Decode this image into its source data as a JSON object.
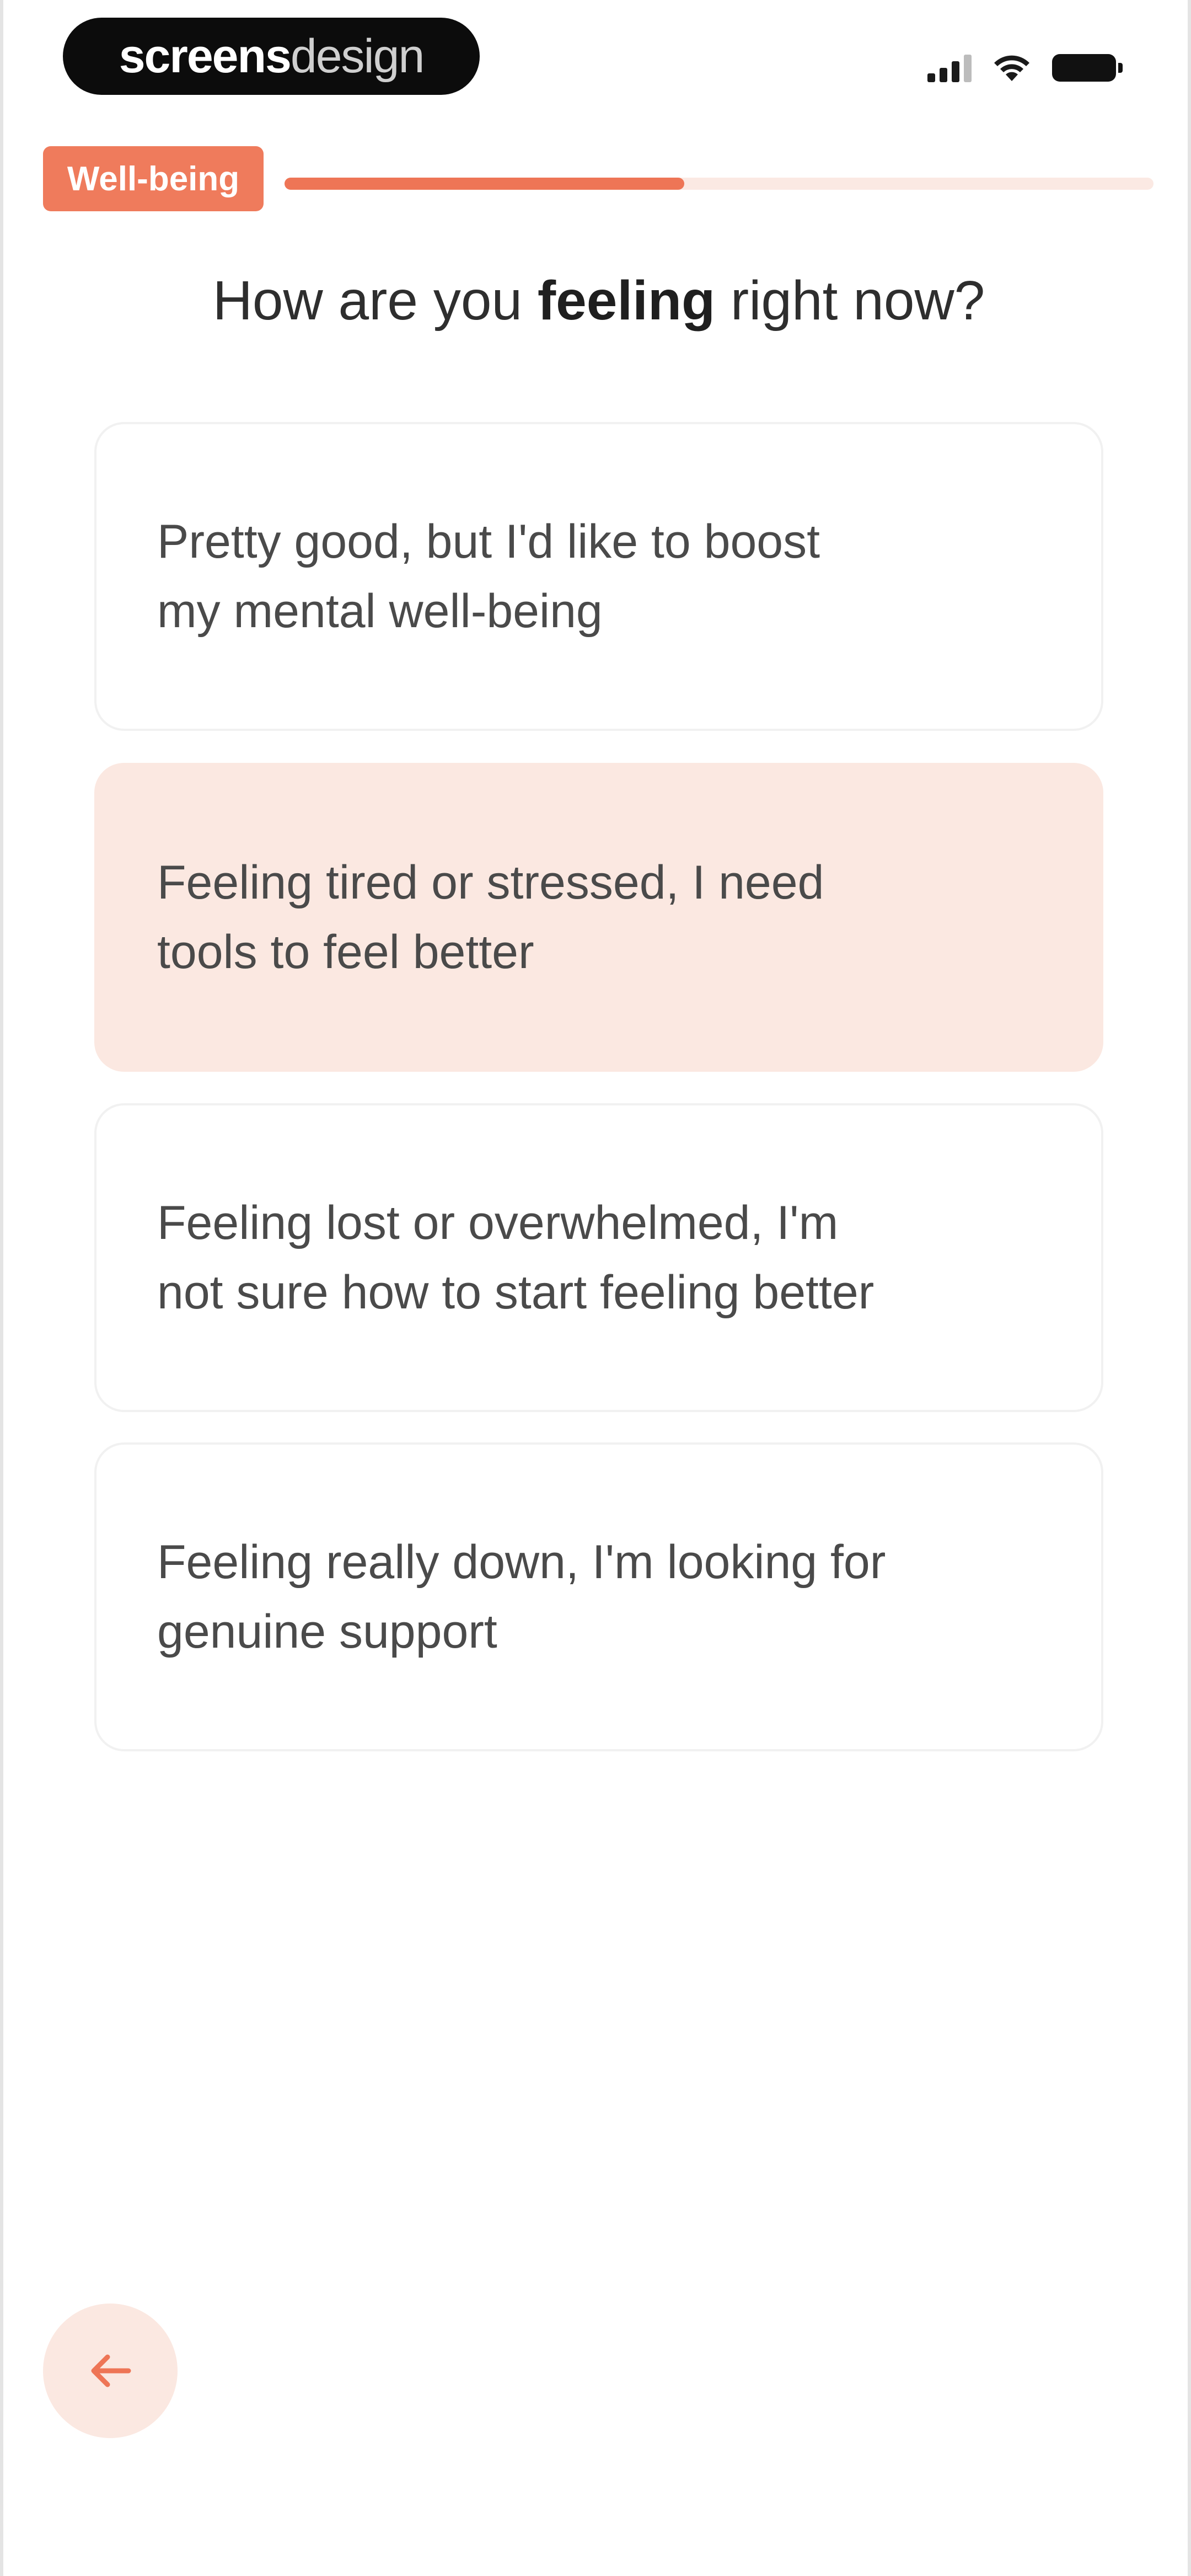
{
  "status_bar": {
    "brand_part1": "screens",
    "brand_part2": "design",
    "signal_icon": "cellular-signal-icon",
    "wifi_icon": "wifi-icon",
    "battery_icon": "battery-icon"
  },
  "header": {
    "tag_label": "Well-being",
    "progress_fraction": 0.46
  },
  "question": {
    "prefix": "How are you ",
    "emphasis": "feeling",
    "suffix": " right now?"
  },
  "options": [
    {
      "line1": "Pretty good, but I'd like to boost",
      "line2": "my mental well-being",
      "selected": false
    },
    {
      "line1": "Feeling tired or stressed, I need",
      "line2": "tools to feel better",
      "selected": true
    },
    {
      "line1": "Feeling lost or overwhelmed, I'm",
      "line2": "not sure how to start feeling better",
      "selected": false
    },
    {
      "line1": "Feeling really down, I'm looking for",
      "line2": "genuine support",
      "selected": false
    }
  ],
  "back_button": {
    "icon": "arrow-left-icon"
  },
  "colors": {
    "accent": "#ee7556",
    "accent_light": "#fbe8e1"
  }
}
